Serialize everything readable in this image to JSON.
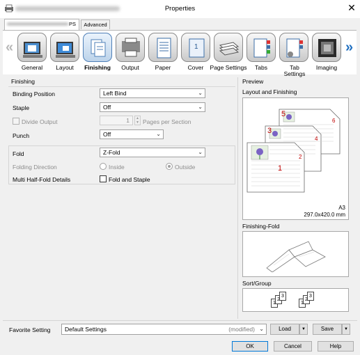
{
  "window": {
    "title": "Properties",
    "close_glyph": "✕"
  },
  "tabs": [
    {
      "label": "PS"
    },
    {
      "label": "Advanced"
    }
  ],
  "ribbon": {
    "prev_glyph": "«",
    "next_glyph": "»",
    "items": [
      {
        "label": "General",
        "icon": "general-icon"
      },
      {
        "label": "Layout",
        "icon": "layout-icon"
      },
      {
        "label": "Finishing",
        "icon": "finishing-icon",
        "selected": true
      },
      {
        "label": "Output",
        "icon": "output-icon"
      },
      {
        "label": "Paper",
        "icon": "paper-icon"
      },
      {
        "label": "Cover",
        "icon": "cover-icon",
        "badge": "1"
      },
      {
        "label": "Page Settings",
        "icon": "page-settings-icon"
      },
      {
        "label": "Tabs",
        "icon": "tabs-icon"
      },
      {
        "label": "Tab Settings",
        "icon": "tab-settings-icon"
      },
      {
        "label": "Imaging",
        "icon": "imaging-icon"
      }
    ]
  },
  "finishing": {
    "section_title": "Finishing",
    "binding_position": {
      "label": "Binding Position",
      "value": "Left Bind"
    },
    "staple": {
      "label": "Staple",
      "value": "Off"
    },
    "divide_output": {
      "label": "Divide Output",
      "value": "1",
      "suffix": "Pages per Section",
      "enabled": false
    },
    "punch": {
      "label": "Punch",
      "value": "Off"
    },
    "fold": {
      "label": "Fold",
      "value": "Z-Fold"
    },
    "folding_direction": {
      "label": "Folding Direction",
      "inside": "Inside",
      "outside": "Outside",
      "selected": "Outside",
      "enabled": false
    },
    "multi_half_fold": {
      "label": "Multi Half-Fold Details",
      "option": "Fold and Staple",
      "checked": false
    }
  },
  "preview": {
    "title": "Preview",
    "layout_title": "Layout and Finishing",
    "page_numbers": [
      "1",
      "2",
      "3",
      "4",
      "5",
      "6"
    ],
    "paper_size": "A3",
    "paper_dims": "297.0x420.0 mm",
    "fold_title": "Finishing-Fold",
    "sort_title": "Sort/Group",
    "sort_digits": [
      "1",
      "2",
      "3"
    ]
  },
  "favorite": {
    "label": "Favorite Setting",
    "value": "Default Settings",
    "status": "(modified)",
    "load_label": "Load",
    "save_label": "Save"
  },
  "footer": {
    "ok": "OK",
    "cancel": "Cancel",
    "help": "Help"
  },
  "colors": {
    "accent": "#0078d7",
    "selected_tab_border": "#4e7fb7",
    "page_number": "#c00000",
    "disabled_text": "#8d8d8d"
  }
}
